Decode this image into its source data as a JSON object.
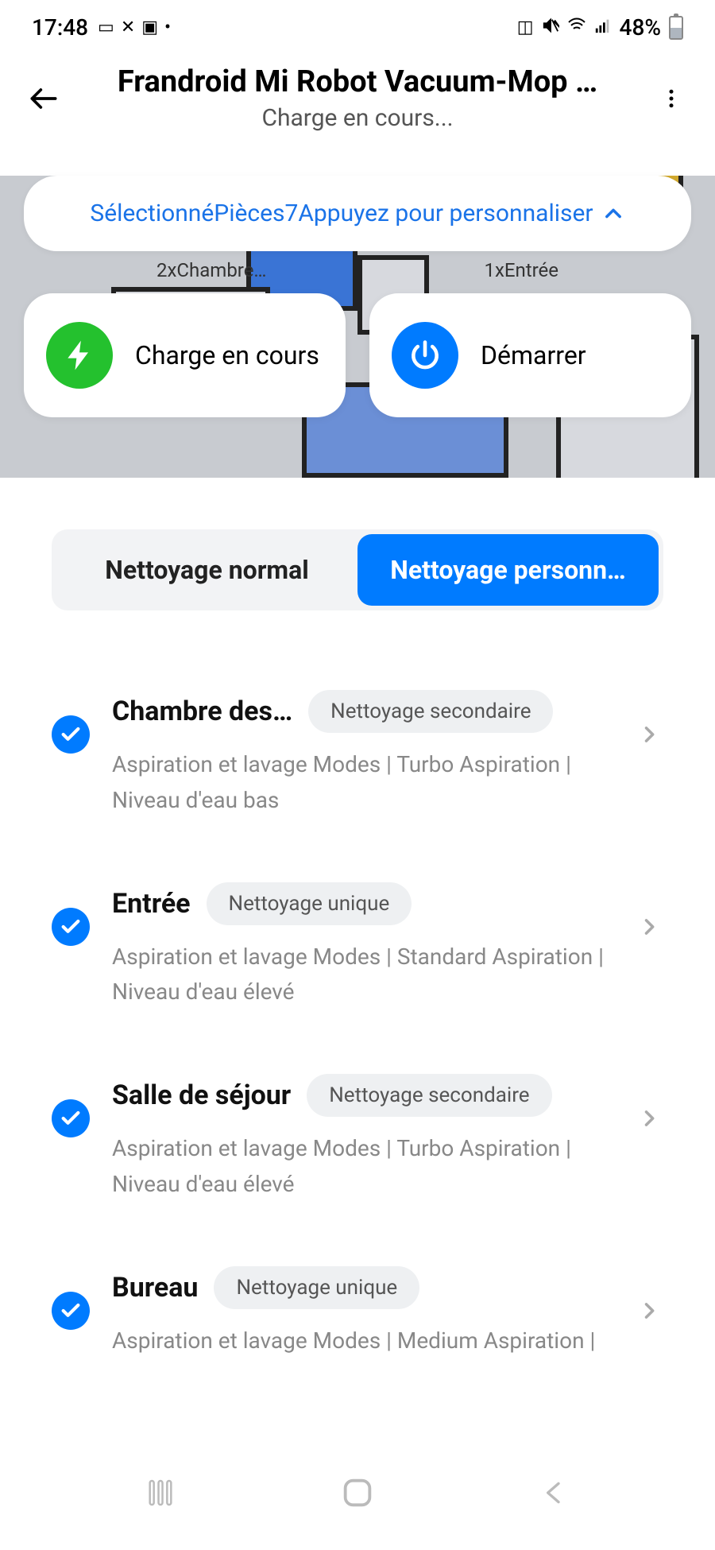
{
  "status_bar": {
    "time": "17:48",
    "battery_pct": "48%"
  },
  "header": {
    "title": "Frandroid Mi Robot Vacuum-Mop …",
    "subtitle": "Charge en cours..."
  },
  "selection_banner": {
    "text": "SélectionnéPièces7Appuyez pour personnaliser"
  },
  "map_labels": {
    "left": "2xChambre…",
    "right": "1xEntrée"
  },
  "actions": {
    "charge_label": "Charge en cours",
    "start_label": "Démarrer"
  },
  "tabs": {
    "normal": "Nettoyage normal",
    "custom": "Nettoyage personn…"
  },
  "rooms": [
    {
      "name": "Chambre des…",
      "badge": "Nettoyage secondaire",
      "desc": "Aspiration et lavage Modes  |  Turbo Aspiration  |  Niveau d'eau bas"
    },
    {
      "name": "Entrée",
      "badge": "Nettoyage unique",
      "desc": "Aspiration et lavage Modes  |  Standard Aspiration  |  Niveau d'eau élevé"
    },
    {
      "name": "Salle de séjour",
      "badge": "Nettoyage secondaire",
      "desc": "Aspiration et lavage Modes  |  Turbo Aspiration  |  Niveau d'eau élevé"
    },
    {
      "name": "Bureau",
      "badge": "Nettoyage unique",
      "desc": "Aspiration et lavage Modes  |  Medium Aspiration  |"
    }
  ]
}
